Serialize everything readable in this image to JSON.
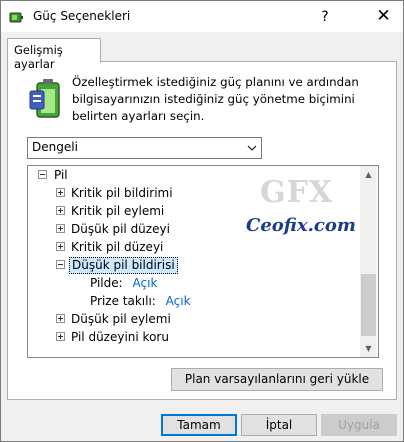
{
  "window": {
    "title": "Güç Seçenekleri",
    "help_glyph": "?",
    "close_glyph": "✕",
    "app_icon": "battery-settings-icon"
  },
  "tabs": [
    {
      "label": "Gelişmiş ayarlar",
      "selected": true
    }
  ],
  "description": {
    "icon": "battery-icon",
    "text": "Özelleştirmek istediğiniz güç planını ve ardından bilgisayarınızın istediğiniz güç yönetme biçimini belirten ayarları seçin."
  },
  "plan_select": {
    "value": "Dengeli",
    "arrow_icon": "chevron-down-icon"
  },
  "tree": {
    "root": {
      "label": "Pil",
      "expanded": true
    },
    "items": [
      {
        "label": "Kritik pil bildirimi",
        "expanded": false
      },
      {
        "label": "Kritik pil eylemi",
        "expanded": false
      },
      {
        "label": "Düşük pil düzeyi",
        "expanded": false
      },
      {
        "label": "Kritik pil düzeyi",
        "expanded": false
      },
      {
        "label": "Düşük pil bildirisi",
        "expanded": true,
        "selected": true,
        "children": [
          {
            "label": "Pilde:",
            "value": "Açık"
          },
          {
            "label": "Prize takılı:",
            "value": "Açık"
          }
        ]
      },
      {
        "label": "Düşük pil eylemi",
        "expanded": false
      },
      {
        "label": "Pil düzeyini koru",
        "expanded": false
      }
    ]
  },
  "restore_button": "Plan varsayılanlarını geri yükle",
  "buttons": {
    "ok": "Tamam",
    "cancel": "İptal",
    "apply": "Uygula"
  },
  "watermark": {
    "logo_text": "GFX",
    "site": "Ceofix.com"
  },
  "colors": {
    "selection": "#cce8ff",
    "link": "#0066cc",
    "accent": "#0078d7"
  }
}
